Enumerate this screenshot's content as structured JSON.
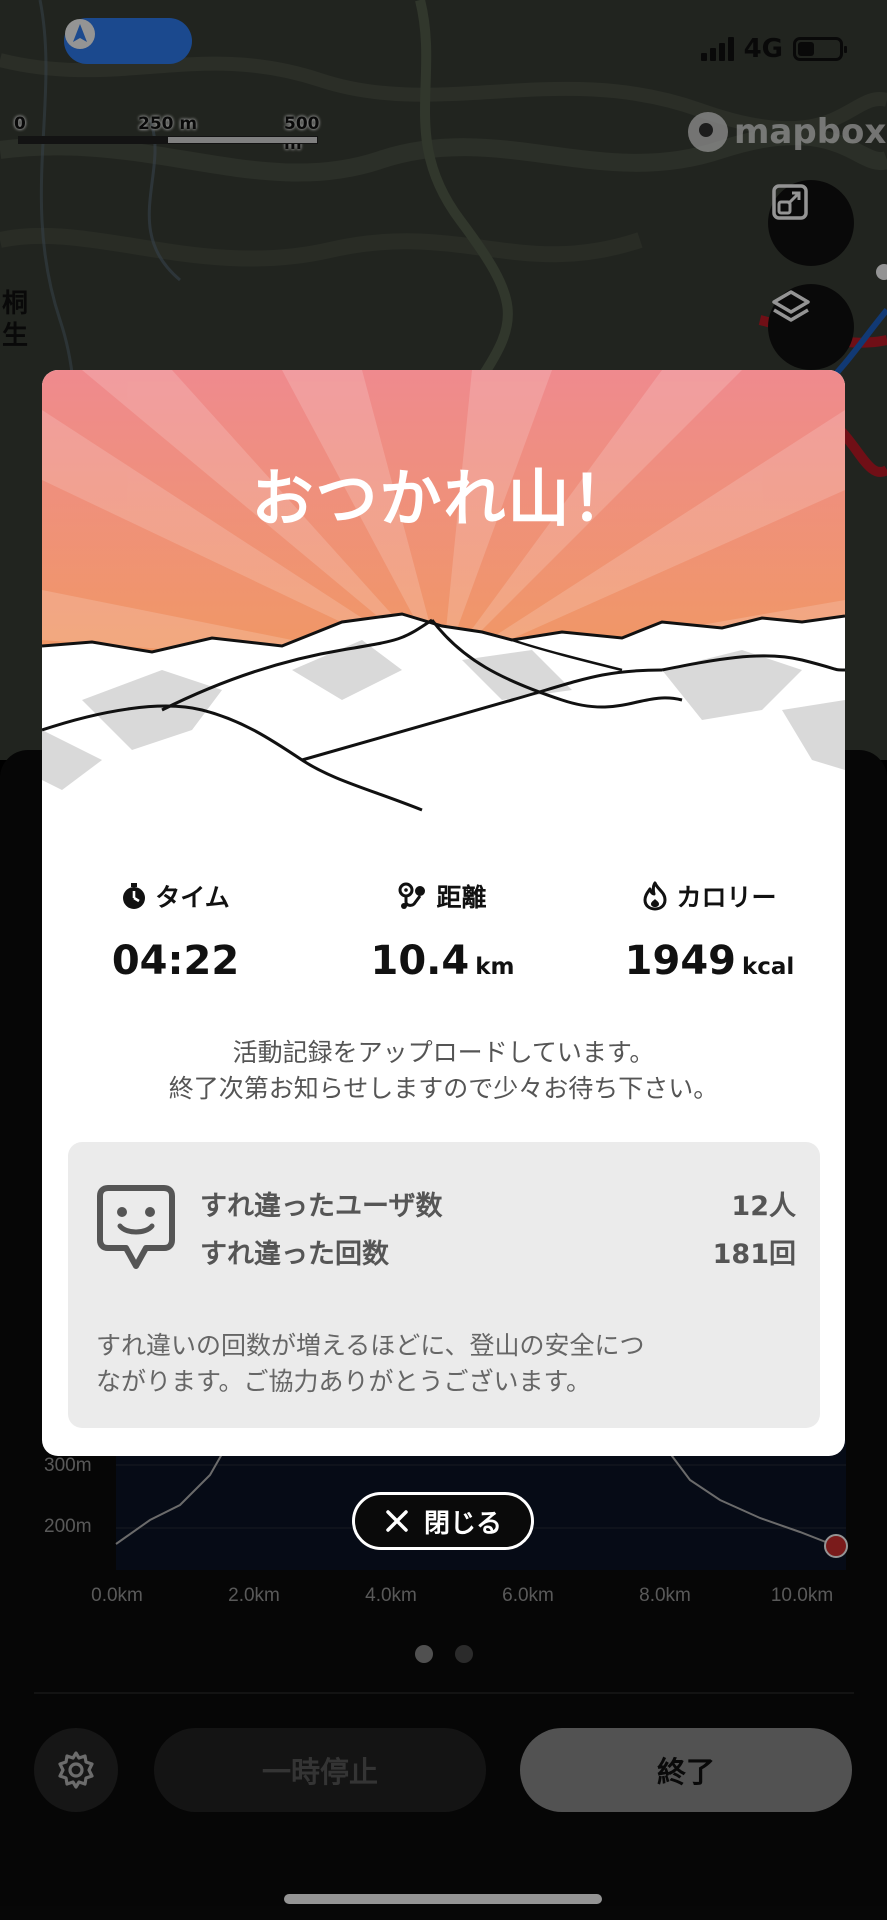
{
  "status_bar": {
    "network": "4G",
    "nav_icon": "navigation-arrow-icon",
    "battery_level": 0.4
  },
  "map": {
    "scale_labels": [
      "0",
      "250 m",
      "500 m"
    ],
    "attribution": "mapbox",
    "place_label": "桐生",
    "buttons": [
      "fit-route-icon",
      "layers-icon"
    ]
  },
  "modal": {
    "title": "おつかれ山！",
    "stats": [
      {
        "label": "タイム",
        "icon": "stopwatch-icon",
        "value": "04:22",
        "unit": ""
      },
      {
        "label": "距離",
        "icon": "route-pin-icon",
        "value": "10.4",
        "unit": "km"
      },
      {
        "label": "カロリー",
        "icon": "flame-icon",
        "value": "1949",
        "unit": "kcal"
      }
    ],
    "upload_message_line1": "活動記録をアップロードしています。",
    "upload_message_line2": "終了次第お知らせしますので少々お待ち下さい。",
    "pass_by": {
      "users_label": "すれ違ったユーザ数",
      "users_value": "12人",
      "times_label": "すれ違った回数",
      "times_value": "181回",
      "note_line1": "すれ違いの回数が増えるほどに、登山の安全につ",
      "note_line2": "ながります。ご協力ありがとうございます。"
    }
  },
  "close_button": {
    "label": "閉じる",
    "icon": "close-icon"
  },
  "elevation_chart": {
    "y_ticks": [
      "300m",
      "200m"
    ],
    "x_ticks": [
      "0.0km",
      "2.0km",
      "4.0km",
      "6.0km",
      "8.0km",
      "10.0km"
    ]
  },
  "chart_data": {
    "type": "area",
    "x": [
      0.0,
      2.0,
      4.0,
      6.0,
      8.0,
      10.0
    ],
    "xlabel": "",
    "ylabel": "",
    "x_tick_labels": [
      "0.0km",
      "2.0km",
      "4.0km",
      "6.0km",
      "8.0km",
      "10.0km"
    ],
    "y_tick_labels": [
      "300m",
      "200m"
    ]
  },
  "controls": {
    "pause_label": "一時停止",
    "end_label": "終了",
    "settings_icon": "gear-icon"
  },
  "pager": {
    "pages": 2,
    "active": 0
  },
  "colors": {
    "hero_top": "#f08a8e",
    "hero_bottom": "#f0a050",
    "nav_pill": "#2f7ef4",
    "end_button": "#8e8e8e"
  }
}
